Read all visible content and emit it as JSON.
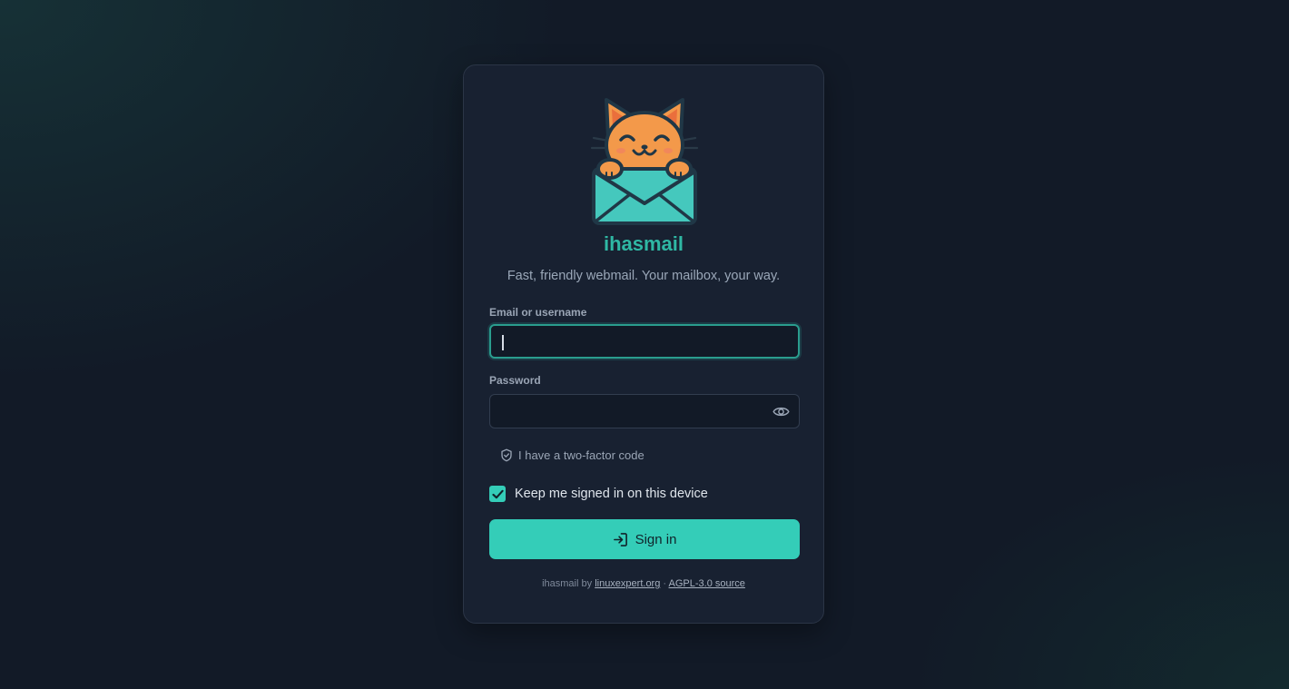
{
  "app": {
    "name": "ihasmail",
    "tagline": "Fast, friendly webmail. Your mailbox, your way."
  },
  "form": {
    "username_label": "Email or username",
    "username_value": "",
    "password_label": "Password",
    "password_value": "",
    "two_factor_label": "I have a two-factor code",
    "keep_signed_in_label": "Keep me signed in on this device",
    "keep_signed_in_checked": true,
    "submit_label": "Sign in"
  },
  "footer": {
    "prefix": "ihasmail by",
    "author_link": "linuxexpert.org",
    "separator": "·",
    "source_link": "AGPL-3.0 source"
  },
  "icons": {
    "logo": "cat-envelope-logo",
    "password_toggle": "eye-icon",
    "two_factor": "shield-icon",
    "checkbox": "check-icon",
    "submit": "sign-in-icon"
  },
  "colors": {
    "accent": "#34cdb8",
    "brand_text": "#2fb8a4",
    "cat": "#f3994a",
    "envelope": "#45c8bd",
    "card": "#182131",
    "background": "#121a27"
  }
}
